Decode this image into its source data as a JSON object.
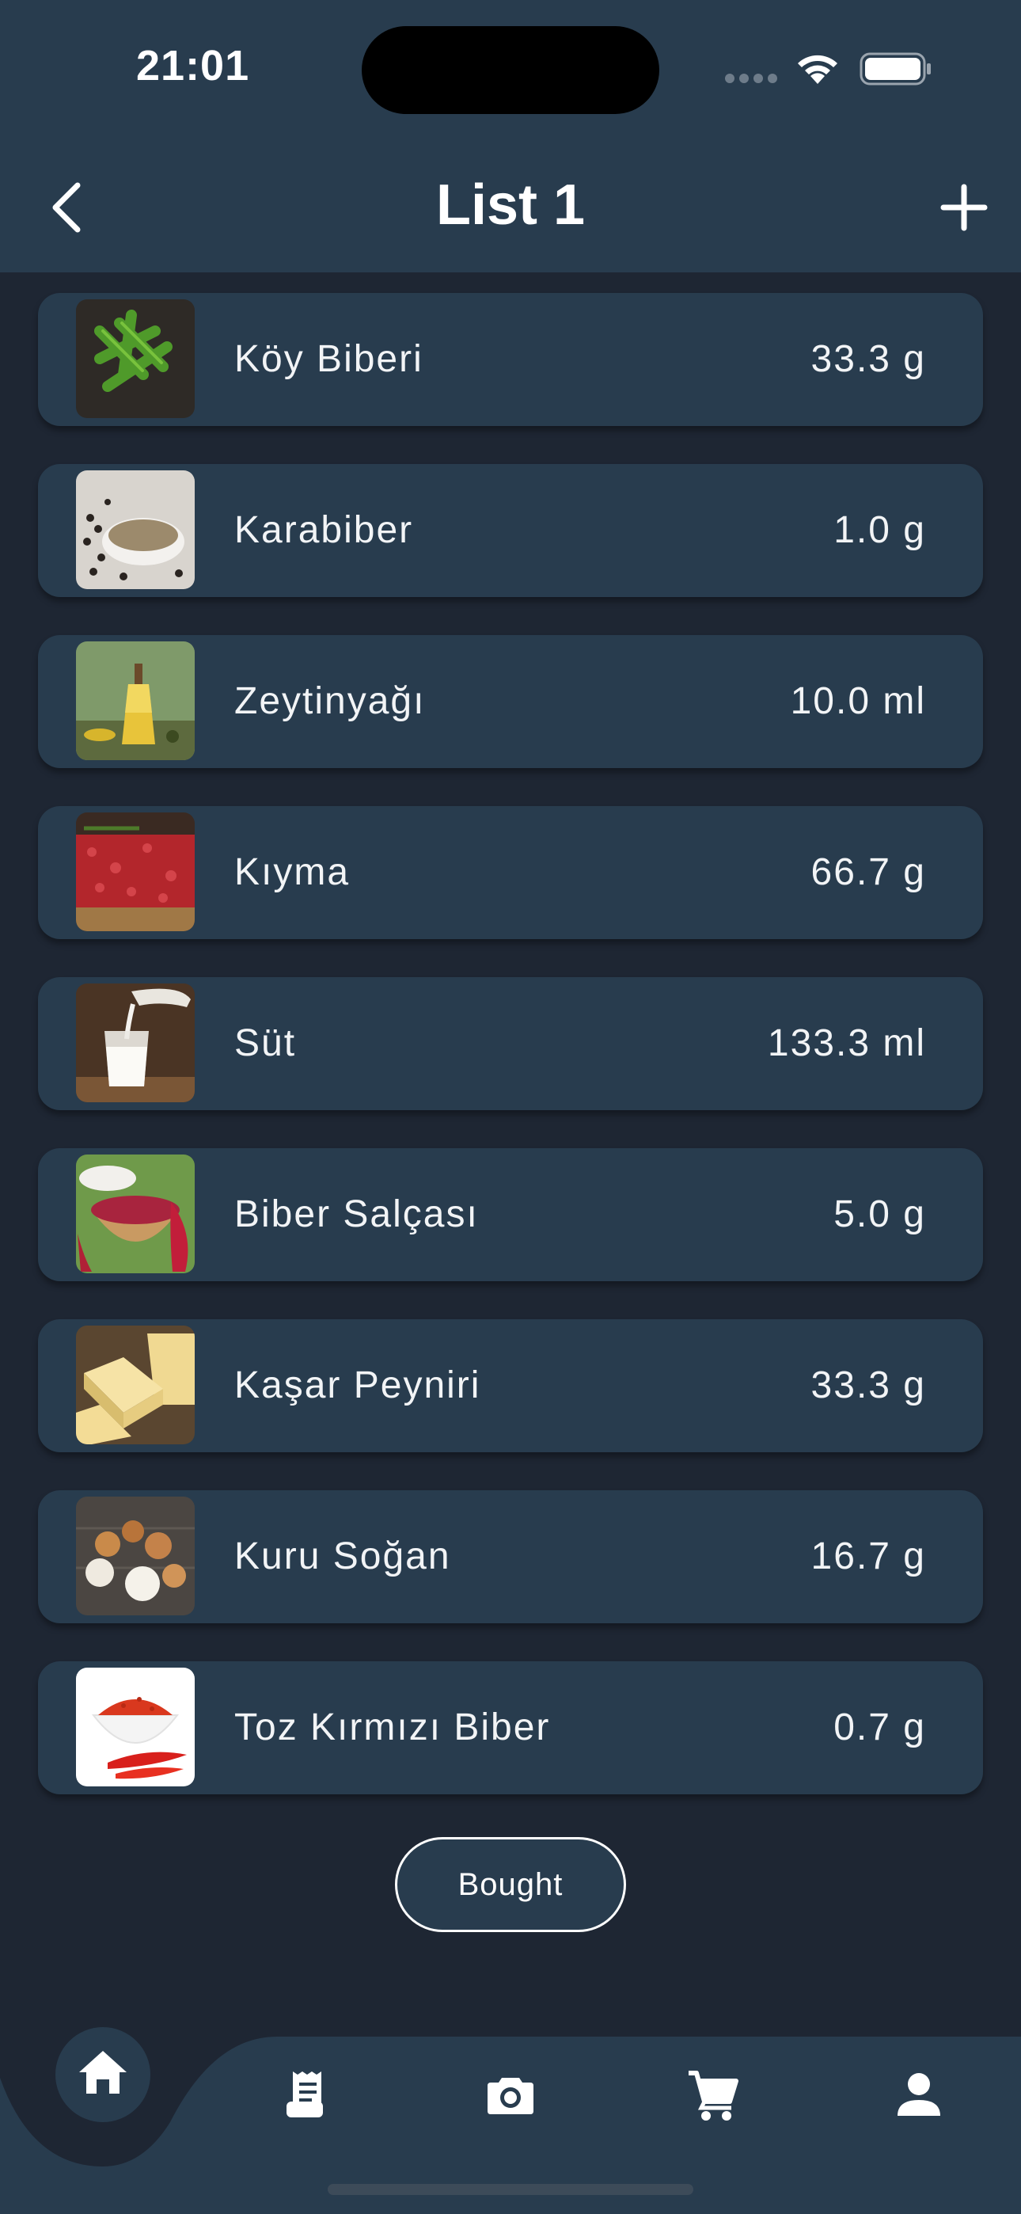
{
  "status_bar": {
    "time": "21:01"
  },
  "header": {
    "title": "List 1"
  },
  "items": [
    {
      "name": "Köy Biberi",
      "qty": "33.3 g"
    },
    {
      "name": "Karabiber",
      "qty": "1.0 g"
    },
    {
      "name": "Zeytinyağı",
      "qty": "10.0 ml"
    },
    {
      "name": "Kıyma",
      "qty": "66.7 g"
    },
    {
      "name": "Süt",
      "qty": "133.3 ml"
    },
    {
      "name": "Biber Salçası",
      "qty": "5.0 g"
    },
    {
      "name": "Kaşar Peyniri",
      "qty": "33.3 g"
    },
    {
      "name": "Kuru Soğan",
      "qty": "16.7 g"
    },
    {
      "name": "Toz Kırmızı Biber",
      "qty": "0.7 g"
    }
  ],
  "actions": {
    "bought_label": "Bought"
  },
  "nav": {
    "tabs": [
      "home-icon",
      "receipt-icon",
      "camera-icon",
      "cart-icon",
      "profile-icon"
    ],
    "active": "home-icon"
  },
  "colors": {
    "background": "#1e2633",
    "surface": "#283c4e",
    "text": "#ffffff"
  }
}
